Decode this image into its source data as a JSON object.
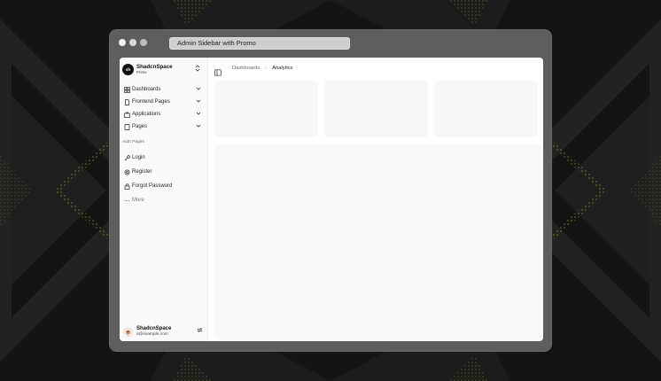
{
  "colors": {
    "page_bg": "#141414",
    "window_frame": "#5e5e5e",
    "app_bg": "#ffffff",
    "sidebar_bg": "#fafafa",
    "card_bg": "#f6f7f9",
    "accent_dots": "#d6d63a"
  },
  "window": {
    "title": "Admin Sidebar with Promo"
  },
  "sidebar": {
    "brand": {
      "logo_text": "sh",
      "name": "ShadcnSpace",
      "plan": "Prime",
      "switch_icon": "chevrons-up-down-icon"
    },
    "nav": [
      {
        "label": "Dashboards",
        "icon": "dashboard-icon",
        "chevron": "chevron-down-icon"
      },
      {
        "label": "Frontend Pages",
        "icon": "file-icon",
        "chevron": "chevron-down-icon"
      },
      {
        "label": "Applications",
        "icon": "briefcase-icon",
        "chevron": "chevron-down-icon"
      },
      {
        "label": "Pages",
        "icon": "page-icon",
        "chevron": "chevron-down-icon"
      }
    ],
    "section_label": "Auth Pages",
    "auth": [
      {
        "label": "Login",
        "icon": "key-icon"
      },
      {
        "label": "Register",
        "icon": "gear-icon"
      },
      {
        "label": "Forgot Password",
        "icon": "lock-icon"
      }
    ],
    "more": {
      "label": "More",
      "icon": "ellipsis-icon"
    },
    "user": {
      "name": "ShadcnSpace",
      "email": "s@example.com",
      "switch_icon": "arrows-swap-icon"
    }
  },
  "main": {
    "toggle_icon": "sidebar-toggle-icon",
    "breadcrumb": {
      "items": [
        "Dashboards",
        "Analytics"
      ],
      "separator": "›"
    }
  }
}
